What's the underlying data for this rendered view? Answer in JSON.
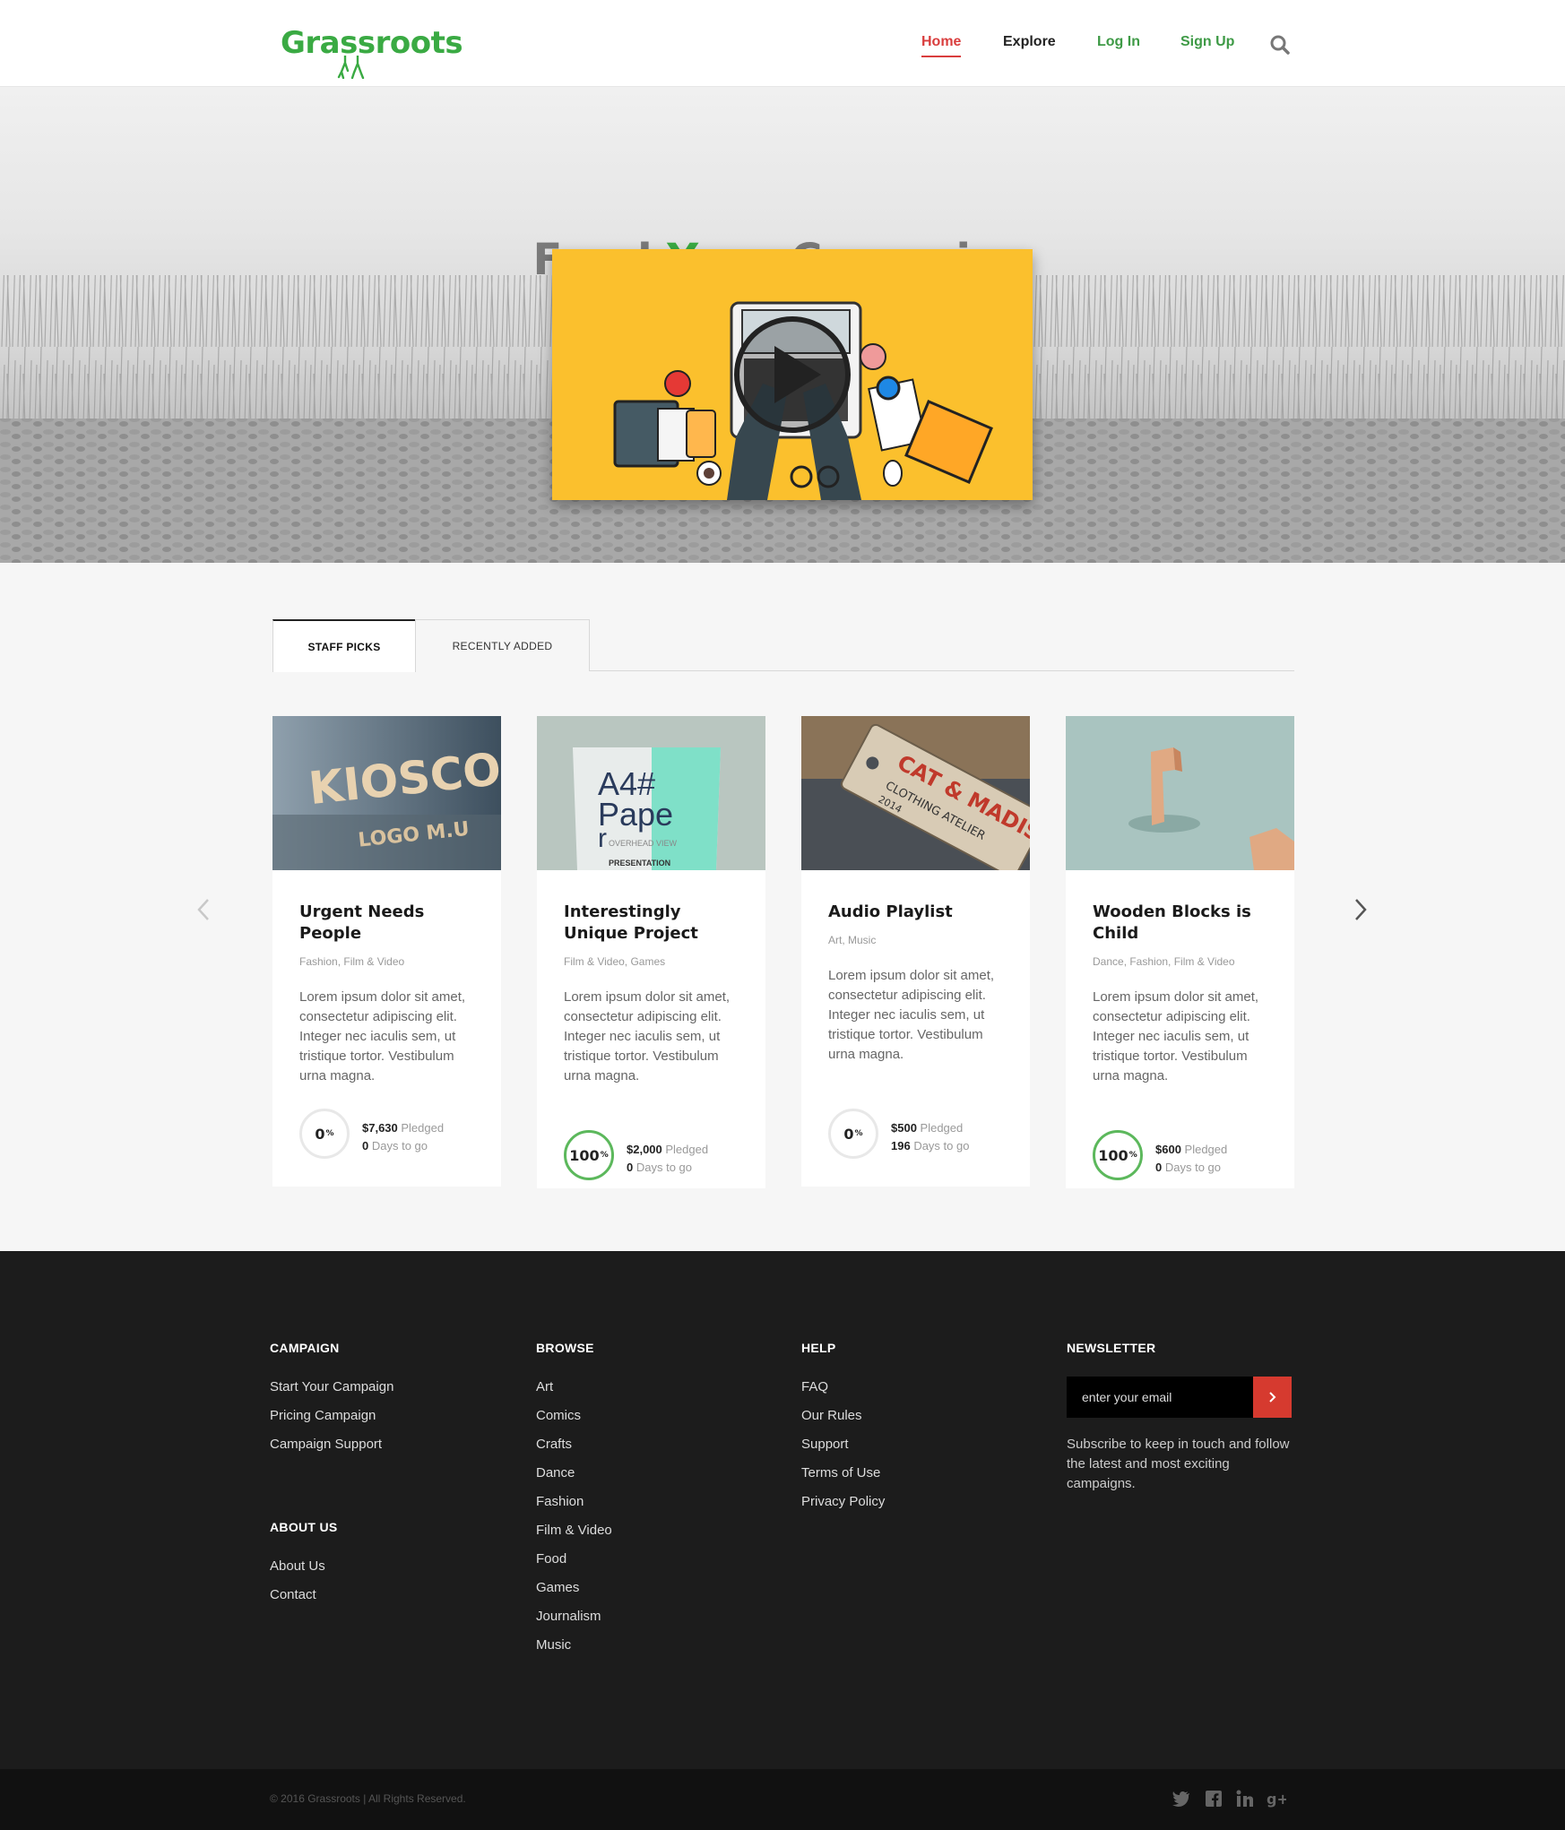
{
  "header": {
    "logo": "Grassroots",
    "nav": {
      "home": "Home",
      "explore": "Explore",
      "login": "Log In",
      "signup": "Sign Up"
    }
  },
  "hero": {
    "title_pre": "Fund ",
    "title_accent": "Your",
    "title_post": " Campaign"
  },
  "tabs": {
    "staff": "Staff Picks",
    "recent": "Recently Added"
  },
  "cards": [
    {
      "title": "Urgent Needs People",
      "categories": "Fashion, Film & Video",
      "text": "Lorem ipsum dolor sit amet, consectetur adipiscing elit. Integer nec iaculis sem, ut tristique tortor. Vestibulum urna magna.",
      "percent": "0",
      "pledged": "$7,630",
      "pledged_label": " Pledged",
      "days": "0",
      "days_label": " Days to go"
    },
    {
      "title": "Interestingly Unique Project",
      "categories": "Film & Video, Games",
      "text": "Lorem ipsum dolor sit amet, consectetur adipiscing elit. Integer nec iaculis sem, ut tristique tortor. Vestibulum urna magna.",
      "percent": "100",
      "pledged": "$2,000",
      "pledged_label": " Pledged",
      "days": "0",
      "days_label": " Days to go"
    },
    {
      "title": "Audio Playlist",
      "categories": "Art, Music",
      "text": "Lorem ipsum dolor sit amet, consectetur adipiscing elit. Integer nec iaculis sem, ut tristique tortor. Vestibulum urna magna.",
      "percent": "0",
      "pledged": "$500",
      "pledged_label": " Pledged",
      "days": "196",
      "days_label": " Days to go"
    },
    {
      "title": "Wooden Blocks is Child",
      "categories": "Dance, Fashion, Film & Video",
      "text": "Lorem ipsum dolor sit amet, consectetur adipiscing elit. Integer nec iaculis sem, ut tristique tortor. Vestibulum urna magna.",
      "percent": "100",
      "pledged": "$600",
      "pledged_label": " Pledged",
      "days": "0",
      "days_label": " Days to go"
    }
  ],
  "card_images": {
    "kiosco_line1": "KIOSCO",
    "kiosco_line2": "LOGO M.U",
    "paper_line1": "A4#",
    "paper_line2": "Pape",
    "paper_line3": "r",
    "paper_sub": "OVERHEAD VIEW",
    "paper_caption": "PRESENTATION",
    "tag_line1": "CAT & MADISON",
    "tag_line2": "CLOTHING ATELIER",
    "tag_year": "2014"
  },
  "footer": {
    "campaign": {
      "heading": "Campaign",
      "links": [
        "Start Your Campaign",
        "Pricing Campaign",
        "Campaign Support"
      ]
    },
    "about": {
      "heading": "About Us",
      "links": [
        "About Us",
        "Contact"
      ]
    },
    "browse": {
      "heading": "Browse",
      "links": [
        "Art",
        "Comics",
        "Crafts",
        "Dance",
        "Fashion",
        "Film & Video",
        "Food",
        "Games",
        "Journalism",
        "Music"
      ]
    },
    "help": {
      "heading": "Help",
      "links": [
        "FAQ",
        "Our Rules",
        "Support",
        "Terms of Use",
        "Privacy Policy"
      ]
    },
    "newsletter": {
      "heading": "Newsletter",
      "placeholder": "enter your email",
      "description": "Subscribe to keep in touch and follow the latest and most exciting campaigns."
    },
    "copyright": "© 2016 Grassroots | All Rights Reserved.",
    "social_icons": [
      "twitter-icon",
      "facebook-icon",
      "linkedin-icon",
      "google-plus-icon"
    ]
  },
  "colors": {
    "brand_green": "#3aaa43",
    "nav_active_red": "#d93d3d",
    "button_red": "#d63a2f",
    "video_yellow": "#fbc02d",
    "footer_bg": "#1c1c1c"
  }
}
